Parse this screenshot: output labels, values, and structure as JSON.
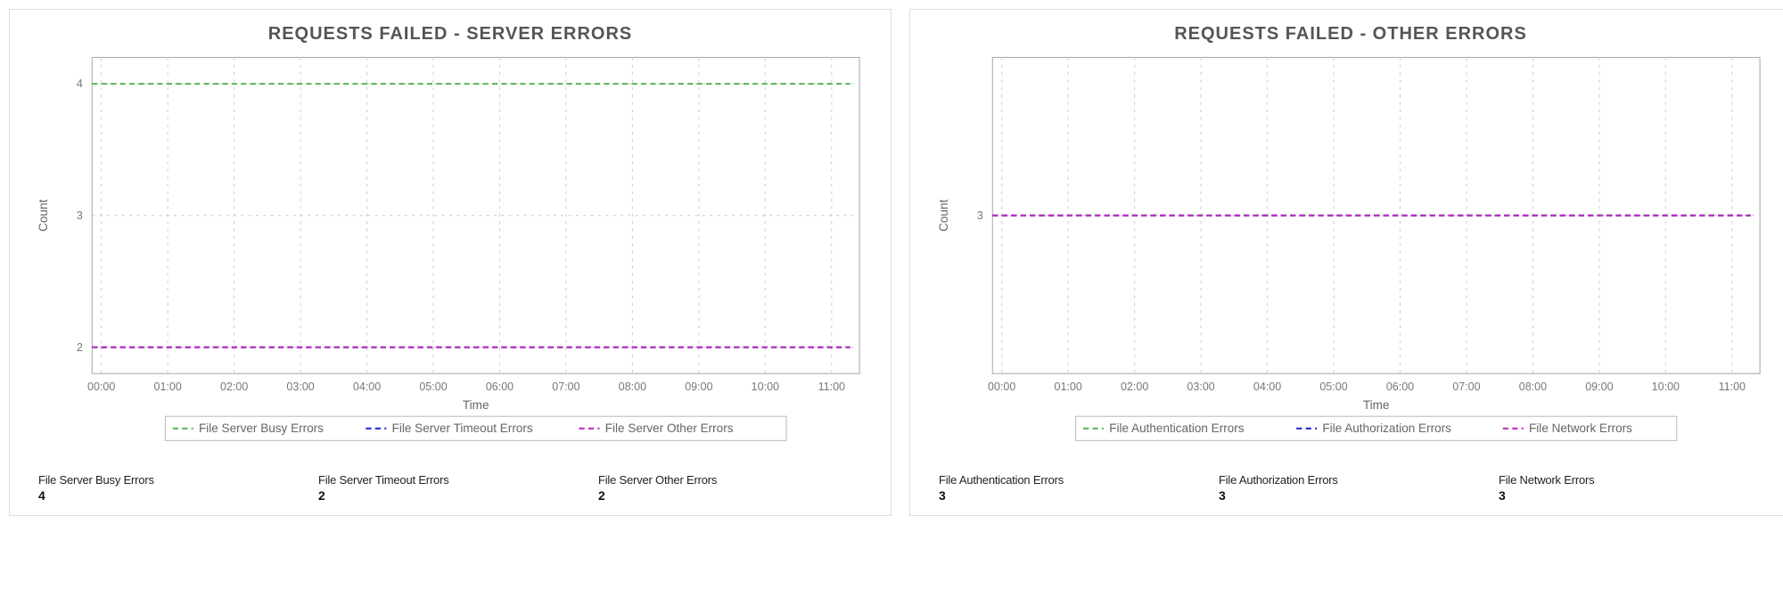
{
  "colors": {
    "green": "#5cb85c",
    "blue": "#2a2ad4",
    "magenta": "#c030c0"
  },
  "panels": [
    {
      "title": "REQUESTS FAILED - SERVER ERRORS",
      "xlabel": "Time",
      "ylabel": "Count",
      "y_ticks": [
        2,
        3,
        4
      ],
      "ylim": [
        1.8,
        4.2
      ],
      "x_ticks": [
        "00:00",
        "01:00",
        "02:00",
        "03:00",
        "04:00",
        "05:00",
        "06:00",
        "07:00",
        "08:00",
        "09:00",
        "10:00",
        "11:00"
      ],
      "series": [
        {
          "name": "File Server Busy Errors",
          "color": "green",
          "value": 4
        },
        {
          "name": "File Server Timeout Errors",
          "color": "blue",
          "value": 2
        },
        {
          "name": "File Server Other Errors",
          "color": "magenta",
          "value": 2
        }
      ],
      "stats": [
        {
          "label": "File Server Busy Errors",
          "value": "4"
        },
        {
          "label": "File Server Timeout Errors",
          "value": "2"
        },
        {
          "label": "File Server Other Errors",
          "value": "2"
        }
      ]
    },
    {
      "title": "REQUESTS FAILED - OTHER ERRORS",
      "xlabel": "Time",
      "ylabel": "Count",
      "y_ticks": [
        3
      ],
      "ylim": [
        2.6,
        3.4
      ],
      "x_ticks": [
        "00:00",
        "01:00",
        "02:00",
        "03:00",
        "04:00",
        "05:00",
        "06:00",
        "07:00",
        "08:00",
        "09:00",
        "10:00",
        "11:00"
      ],
      "series": [
        {
          "name": "File Authentication Errors",
          "color": "green",
          "value": 3
        },
        {
          "name": "File Authorization Errors",
          "color": "blue",
          "value": 3
        },
        {
          "name": "File Network Errors",
          "color": "magenta",
          "value": 3
        }
      ],
      "stats": [
        {
          "label": "File Authentication Errors",
          "value": "3"
        },
        {
          "label": "File Authorization Errors",
          "value": "3"
        },
        {
          "label": "File Network Errors",
          "value": "3"
        }
      ]
    }
  ],
  "chart_data": [
    {
      "type": "line",
      "title": "REQUESTS FAILED - SERVER ERRORS",
      "xlabel": "Time",
      "ylabel": "Count",
      "x": [
        "00:00",
        "01:00",
        "02:00",
        "03:00",
        "04:00",
        "05:00",
        "06:00",
        "07:00",
        "08:00",
        "09:00",
        "10:00",
        "11:00"
      ],
      "ylim": [
        1.8,
        4.2
      ],
      "series": [
        {
          "name": "File Server Busy Errors",
          "values": [
            4,
            4,
            4,
            4,
            4,
            4,
            4,
            4,
            4,
            4,
            4,
            4
          ]
        },
        {
          "name": "File Server Timeout Errors",
          "values": [
            2,
            2,
            2,
            2,
            2,
            2,
            2,
            2,
            2,
            2,
            2,
            2
          ]
        },
        {
          "name": "File Server Other Errors",
          "values": [
            2,
            2,
            2,
            2,
            2,
            2,
            2,
            2,
            2,
            2,
            2,
            2
          ]
        }
      ],
      "legend_position": "bottom",
      "grid": true
    },
    {
      "type": "line",
      "title": "REQUESTS FAILED - OTHER ERRORS",
      "xlabel": "Time",
      "ylabel": "Count",
      "x": [
        "00:00",
        "01:00",
        "02:00",
        "03:00",
        "04:00",
        "05:00",
        "06:00",
        "07:00",
        "08:00",
        "09:00",
        "10:00",
        "11:00"
      ],
      "ylim": [
        2.6,
        3.4
      ],
      "series": [
        {
          "name": "File Authentication Errors",
          "values": [
            3,
            3,
            3,
            3,
            3,
            3,
            3,
            3,
            3,
            3,
            3,
            3
          ]
        },
        {
          "name": "File Authorization Errors",
          "values": [
            3,
            3,
            3,
            3,
            3,
            3,
            3,
            3,
            3,
            3,
            3,
            3
          ]
        },
        {
          "name": "File Network Errors",
          "values": [
            3,
            3,
            3,
            3,
            3,
            3,
            3,
            3,
            3,
            3,
            3,
            3
          ]
        }
      ],
      "legend_position": "bottom",
      "grid": true
    }
  ]
}
